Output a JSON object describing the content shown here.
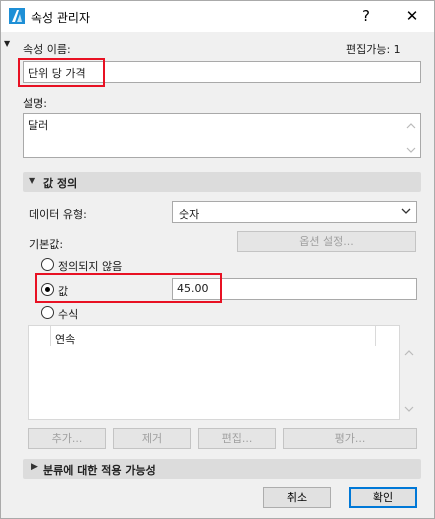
{
  "window": {
    "title": "속성 관리자",
    "help_label": "?",
    "close_label": "✕"
  },
  "header": {
    "name_label": "속성 이름:",
    "editable_label": "편집가능: 1",
    "name_value": "단위 당 가격"
  },
  "description": {
    "label": "설명:",
    "value": "달러"
  },
  "value_definition": {
    "section_title": "값 정의",
    "data_type_label": "데이터 유형:",
    "data_type_value": "숫자",
    "default_label": "기본값:",
    "options_button": "옵션 설정...",
    "radio_undefined": "정의되지 않음",
    "radio_value": "값",
    "radio_formula": "수식",
    "value_input": "45.00",
    "list_header": "연속",
    "buttons": {
      "add": "추가...",
      "remove": "제거",
      "edit": "편집...",
      "evaluate": "평가..."
    }
  },
  "classification": {
    "section_title": "분류에 대한 적용 가능성"
  },
  "footer": {
    "cancel": "취소",
    "ok": "확인"
  },
  "colors": {
    "highlight": "#e81123",
    "accent": "#0078d7"
  }
}
